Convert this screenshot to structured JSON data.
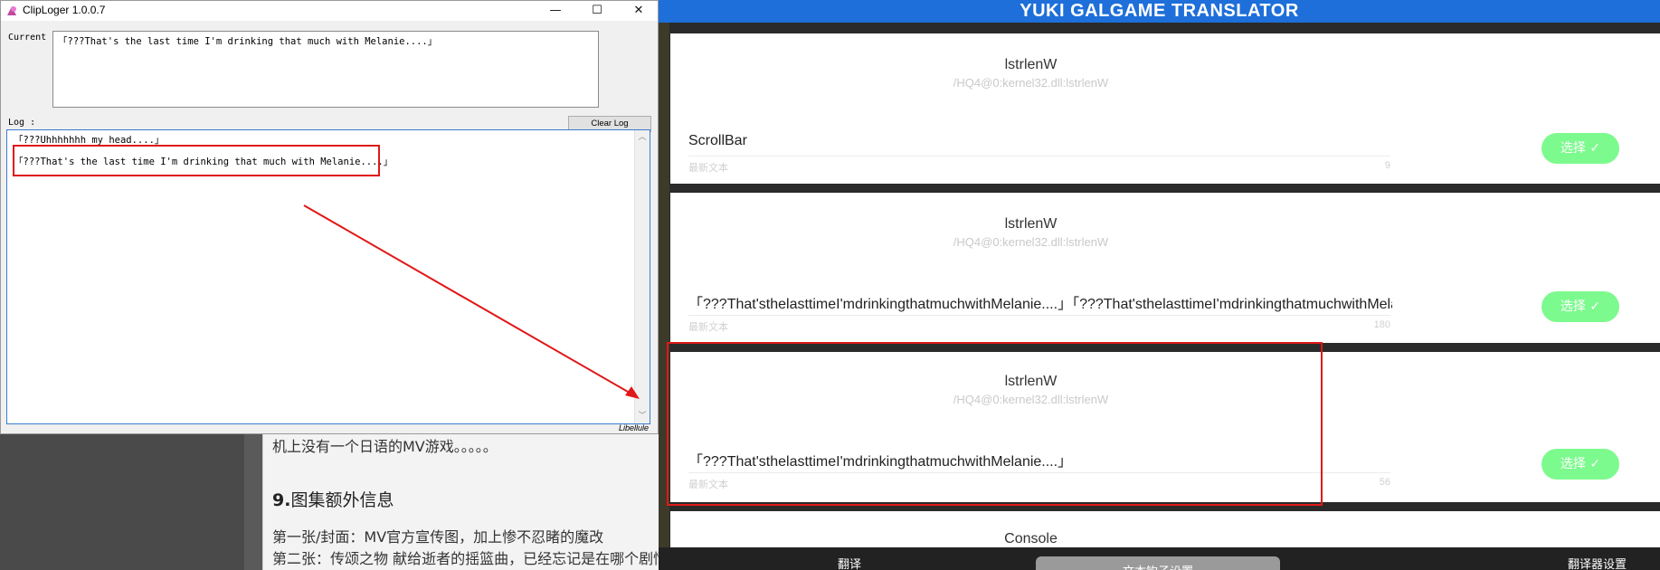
{
  "article": {
    "line1": "机上没有一个日语的MV游戏。。。。。",
    "heading_num": "9.",
    "heading": "图集额外信息",
    "line2": "第一张/封面：MV官方宣传图，加上惨不忍睹的魔改",
    "line3": "第二张：传颂之物 献给逝者的摇篮曲，已经忘记是在哪个剧情"
  },
  "clip": {
    "title": "ClipLoger 1.0.0.7",
    "minimize": "—",
    "maximize": "☐",
    "close": "✕",
    "current_label": "Current",
    "current_text": "「???That's the last time I'm drinking that much with Melanie....」",
    "log_label": "Log :",
    "clear_log": "Clear Log",
    "log_lines": [
      "「???Uhhhhhhh my head....」",
      "「???That's the last time I'm drinking that much with Melanie....」"
    ],
    "scroll_up": "︿",
    "scroll_down": "﹀",
    "status": "Libellule"
  },
  "yuki": {
    "title": "YUKI GALGAME TRANSLATOR",
    "select_label": "选择  ✓",
    "recent_text_label": "最新文本",
    "cards": [
      {
        "function": "lstrlenW",
        "hook": "/HQ4@0:kernel32.dll:lstrlenW",
        "text": "ScrollBar",
        "count": "9"
      },
      {
        "function": "lstrlenW",
        "hook": "/HQ4@0:kernel32.dll:lstrlenW",
        "text": "「???That'sthelasttimeI'mdrinkingthatmuchwithMelanie....」「???That'sthelasttimeI'mdrinkingthatmuchwithMelanie....」",
        "count": "180"
      },
      {
        "function": "lstrlenW",
        "hook": "/HQ4@0:kernel32.dll:lstrlenW",
        "text": "「???That'sthelasttimeI'mdrinkingthatmuchwithMelanie....」",
        "count": "56"
      },
      {
        "function": "Console"
      }
    ],
    "tabs": [
      "翻译",
      "文本钩子设置",
      "翻译器设置"
    ]
  },
  "colors": {
    "header_blue": "#1e6fd9",
    "select_green": "#7dfa8e",
    "annotation_red": "#e01818"
  }
}
